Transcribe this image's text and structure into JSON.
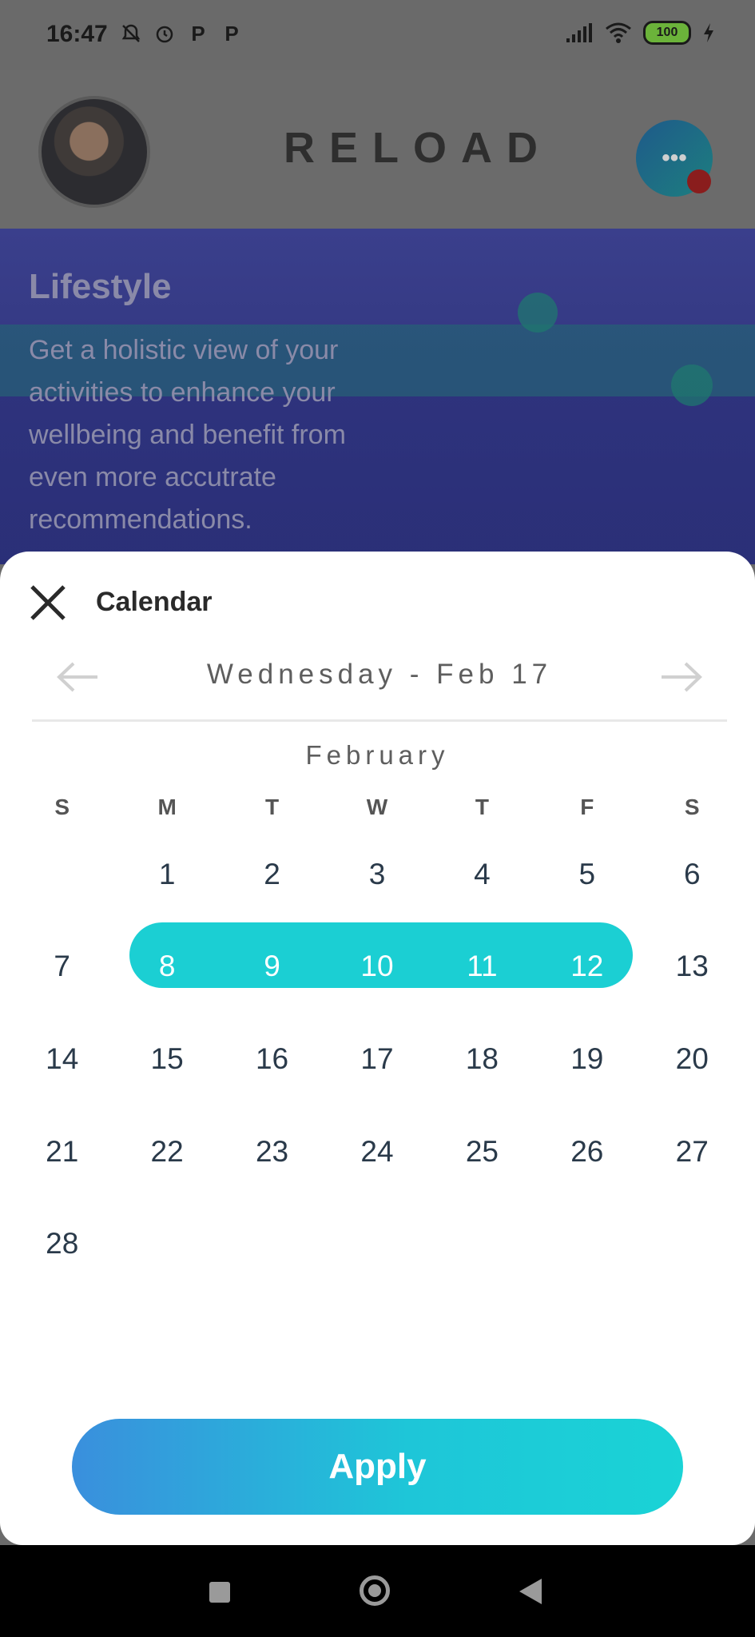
{
  "status_bar": {
    "time": "16:47",
    "battery": "100"
  },
  "app": {
    "logo": "RELOAD",
    "hero_title": "Lifestyle",
    "hero_text": "Get a holistic view of your activities to enhance your wellbeing and benefit from even more accutrate recommendations."
  },
  "calendar": {
    "title": "Calendar",
    "selected_date": "Wednesday - Feb 17",
    "month": "February",
    "weekdays": [
      "S",
      "M",
      "T",
      "W",
      "T",
      "F",
      "S"
    ],
    "weeks": [
      [
        "",
        "1",
        "2",
        "3",
        "4",
        "5",
        "6"
      ],
      [
        "7",
        "8",
        "9",
        "10",
        "11",
        "12",
        "13"
      ],
      [
        "14",
        "15",
        "16",
        "17",
        "18",
        "19",
        "20"
      ],
      [
        "21",
        "22",
        "23",
        "24",
        "25",
        "26",
        "27"
      ],
      [
        "28",
        "",
        "",
        "",
        "",
        "",
        ""
      ]
    ],
    "selected_range": [
      "8",
      "9",
      "10",
      "11",
      "12"
    ],
    "apply_label": "Apply"
  },
  "colors": {
    "accent": "#1bcfd3",
    "apply_gradient_start": "#3a8fdd",
    "day_text": "#2a3a4a"
  },
  "icons": [
    "close-icon",
    "arrow-left-icon",
    "arrow-right-icon",
    "chat-icon",
    "battery-icon",
    "wifi-icon",
    "signal-icon"
  ]
}
